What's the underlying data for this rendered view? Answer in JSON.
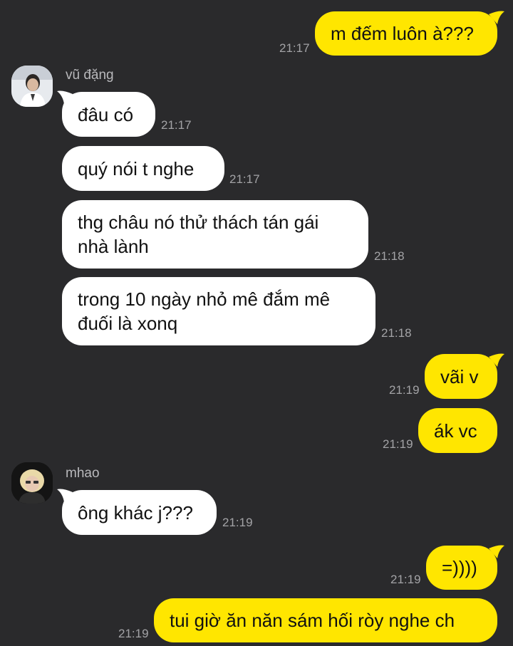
{
  "messages": [
    {
      "id": "m1",
      "dir": "out",
      "text": "m đếm luôn à???",
      "time": "21:17"
    },
    {
      "id": "m2",
      "dir": "in",
      "sender": "vũ đặng",
      "avatar": "avatar-vu-dang",
      "text": "đâu có",
      "time": "21:17"
    },
    {
      "id": "m3",
      "dir": "in",
      "text": "quý nói t nghe",
      "time": "21:17"
    },
    {
      "id": "m4",
      "dir": "in",
      "text": "thg châu nó thử thách tán gái nhà lành",
      "time": "21:18"
    },
    {
      "id": "m5",
      "dir": "in",
      "text": "trong 10 ngày nhỏ mê đắm mê đuối là xonq",
      "time": "21:18"
    },
    {
      "id": "m6",
      "dir": "out",
      "text": "vãi v",
      "time": "21:19"
    },
    {
      "id": "m7",
      "dir": "out",
      "text": "ák vc",
      "time": "21:19"
    },
    {
      "id": "m8",
      "dir": "in",
      "sender": "mhao",
      "avatar": "avatar-mhao",
      "text": "ông khác j???",
      "time": "21:19"
    },
    {
      "id": "m9",
      "dir": "out",
      "text": "=))))",
      "time": "21:19"
    },
    {
      "id": "m10",
      "dir": "out",
      "text": "tui giờ ăn năn sám hối ròy nghe ch",
      "time": "21:19"
    }
  ],
  "colors": {
    "background": "#2a2a2c",
    "incoming_bubble": "#ffffff",
    "outgoing_bubble": "#ffe600",
    "timestamp": "#a3a3a6",
    "sender_name": "#b9b9bc"
  }
}
